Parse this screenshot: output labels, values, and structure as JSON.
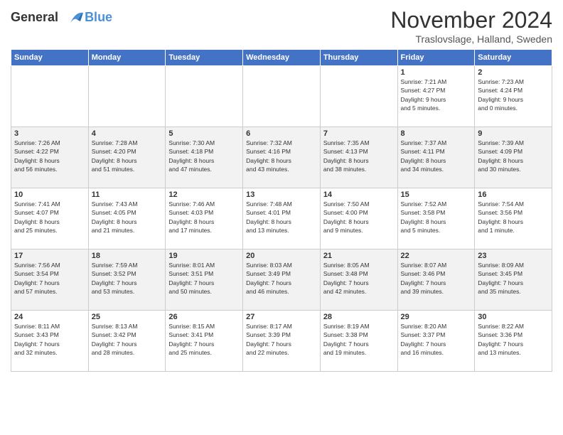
{
  "header": {
    "logo_line1": "General",
    "logo_line2": "Blue",
    "month": "November 2024",
    "location": "Traslovslage, Halland, Sweden"
  },
  "weekdays": [
    "Sunday",
    "Monday",
    "Tuesday",
    "Wednesday",
    "Thursday",
    "Friday",
    "Saturday"
  ],
  "weeks": [
    [
      {
        "day": "",
        "info": ""
      },
      {
        "day": "",
        "info": ""
      },
      {
        "day": "",
        "info": ""
      },
      {
        "day": "",
        "info": ""
      },
      {
        "day": "",
        "info": ""
      },
      {
        "day": "1",
        "info": "Sunrise: 7:21 AM\nSunset: 4:27 PM\nDaylight: 9 hours\nand 5 minutes."
      },
      {
        "day": "2",
        "info": "Sunrise: 7:23 AM\nSunset: 4:24 PM\nDaylight: 9 hours\nand 0 minutes."
      }
    ],
    [
      {
        "day": "3",
        "info": "Sunrise: 7:26 AM\nSunset: 4:22 PM\nDaylight: 8 hours\nand 56 minutes."
      },
      {
        "day": "4",
        "info": "Sunrise: 7:28 AM\nSunset: 4:20 PM\nDaylight: 8 hours\nand 51 minutes."
      },
      {
        "day": "5",
        "info": "Sunrise: 7:30 AM\nSunset: 4:18 PM\nDaylight: 8 hours\nand 47 minutes."
      },
      {
        "day": "6",
        "info": "Sunrise: 7:32 AM\nSunset: 4:16 PM\nDaylight: 8 hours\nand 43 minutes."
      },
      {
        "day": "7",
        "info": "Sunrise: 7:35 AM\nSunset: 4:13 PM\nDaylight: 8 hours\nand 38 minutes."
      },
      {
        "day": "8",
        "info": "Sunrise: 7:37 AM\nSunset: 4:11 PM\nDaylight: 8 hours\nand 34 minutes."
      },
      {
        "day": "9",
        "info": "Sunrise: 7:39 AM\nSunset: 4:09 PM\nDaylight: 8 hours\nand 30 minutes."
      }
    ],
    [
      {
        "day": "10",
        "info": "Sunrise: 7:41 AM\nSunset: 4:07 PM\nDaylight: 8 hours\nand 25 minutes."
      },
      {
        "day": "11",
        "info": "Sunrise: 7:43 AM\nSunset: 4:05 PM\nDaylight: 8 hours\nand 21 minutes."
      },
      {
        "day": "12",
        "info": "Sunrise: 7:46 AM\nSunset: 4:03 PM\nDaylight: 8 hours\nand 17 minutes."
      },
      {
        "day": "13",
        "info": "Sunrise: 7:48 AM\nSunset: 4:01 PM\nDaylight: 8 hours\nand 13 minutes."
      },
      {
        "day": "14",
        "info": "Sunrise: 7:50 AM\nSunset: 4:00 PM\nDaylight: 8 hours\nand 9 minutes."
      },
      {
        "day": "15",
        "info": "Sunrise: 7:52 AM\nSunset: 3:58 PM\nDaylight: 8 hours\nand 5 minutes."
      },
      {
        "day": "16",
        "info": "Sunrise: 7:54 AM\nSunset: 3:56 PM\nDaylight: 8 hours\nand 1 minute."
      }
    ],
    [
      {
        "day": "17",
        "info": "Sunrise: 7:56 AM\nSunset: 3:54 PM\nDaylight: 7 hours\nand 57 minutes."
      },
      {
        "day": "18",
        "info": "Sunrise: 7:59 AM\nSunset: 3:52 PM\nDaylight: 7 hours\nand 53 minutes."
      },
      {
        "day": "19",
        "info": "Sunrise: 8:01 AM\nSunset: 3:51 PM\nDaylight: 7 hours\nand 50 minutes."
      },
      {
        "day": "20",
        "info": "Sunrise: 8:03 AM\nSunset: 3:49 PM\nDaylight: 7 hours\nand 46 minutes."
      },
      {
        "day": "21",
        "info": "Sunrise: 8:05 AM\nSunset: 3:48 PM\nDaylight: 7 hours\nand 42 minutes."
      },
      {
        "day": "22",
        "info": "Sunrise: 8:07 AM\nSunset: 3:46 PM\nDaylight: 7 hours\nand 39 minutes."
      },
      {
        "day": "23",
        "info": "Sunrise: 8:09 AM\nSunset: 3:45 PM\nDaylight: 7 hours\nand 35 minutes."
      }
    ],
    [
      {
        "day": "24",
        "info": "Sunrise: 8:11 AM\nSunset: 3:43 PM\nDaylight: 7 hours\nand 32 minutes."
      },
      {
        "day": "25",
        "info": "Sunrise: 8:13 AM\nSunset: 3:42 PM\nDaylight: 7 hours\nand 28 minutes."
      },
      {
        "day": "26",
        "info": "Sunrise: 8:15 AM\nSunset: 3:41 PM\nDaylight: 7 hours\nand 25 minutes."
      },
      {
        "day": "27",
        "info": "Sunrise: 8:17 AM\nSunset: 3:39 PM\nDaylight: 7 hours\nand 22 minutes."
      },
      {
        "day": "28",
        "info": "Sunrise: 8:19 AM\nSunset: 3:38 PM\nDaylight: 7 hours\nand 19 minutes."
      },
      {
        "day": "29",
        "info": "Sunrise: 8:20 AM\nSunset: 3:37 PM\nDaylight: 7 hours\nand 16 minutes."
      },
      {
        "day": "30",
        "info": "Sunrise: 8:22 AM\nSunset: 3:36 PM\nDaylight: 7 hours\nand 13 minutes."
      }
    ]
  ]
}
